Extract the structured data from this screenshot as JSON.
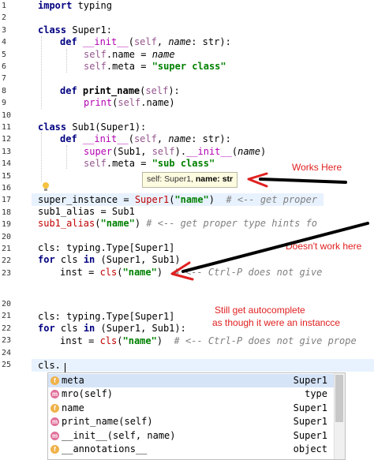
{
  "pane1": {
    "line_numbers": [
      "1",
      "2",
      "3",
      "4",
      "5",
      "6",
      "7",
      "8",
      "9",
      "10",
      "11",
      "12",
      "13",
      "14",
      "15",
      "16",
      "17",
      "18",
      "19",
      "20",
      "21",
      "22",
      "23"
    ],
    "code": {
      "l1": [
        "import",
        " typing"
      ],
      "l3": [
        "class",
        " Super1:"
      ],
      "l4": [
        "def",
        " __init__",
        "(",
        "self",
        ", ",
        "name",
        ": str):"
      ],
      "l5": [
        "self",
        ".name = ",
        "name"
      ],
      "l6": [
        "self",
        ".meta = ",
        "\"super class\""
      ],
      "l8": [
        "def",
        " print_name",
        "(",
        "self",
        "):"
      ],
      "l9": [
        "print",
        "(",
        "self",
        ".name)"
      ],
      "l11": [
        "class",
        " Sub1(Super1):"
      ],
      "l12": [
        "def",
        " __init__",
        "(",
        "self",
        ", ",
        "name",
        ": str):"
      ],
      "l13": [
        "super",
        "(Sub1, ",
        "self",
        ").",
        "__init__",
        "(",
        "name",
        ")"
      ],
      "l14": [
        "self",
        ".meta = ",
        "\"sub class\""
      ],
      "l17": [
        "super_instance = ",
        "Super1",
        "(",
        "\"name\"",
        ")  ",
        "# <-- get proper"
      ],
      "l18": [
        "sub1_alias = Sub1"
      ],
      "l19": [
        "sub1_alias",
        "(",
        "\"name\"",
        ") ",
        "# <-- get proper type hints fo"
      ],
      "l21": [
        "cls: typing.Type[Super1]"
      ],
      "l22": [
        "for",
        " cls ",
        "in",
        " (Super1, Sub1)"
      ],
      "l23": [
        "inst = ",
        "cls",
        "(",
        "\"name\"",
        ")  ",
        "# <-- Ctrl-P does not give"
      ]
    },
    "tooltip": {
      "prefix": "self: Super1, ",
      "bold": "name: str"
    }
  },
  "pane2": {
    "line_numbers": [
      "20",
      "21",
      "22",
      "23",
      "24",
      "25"
    ],
    "code": {
      "l21": [
        "cls: typing.Type[Super1]"
      ],
      "l22": [
        "for",
        " cls ",
        "in",
        " (Super1, Sub1):"
      ],
      "l23": [
        "inst = ",
        "cls",
        "(",
        "\"name\"",
        ")  ",
        "# <-- Ctrl-P does not give prope"
      ],
      "l25": [
        "cls."
      ]
    },
    "autocomplete": [
      {
        "icon": "f",
        "name": "meta",
        "type": "Super1",
        "selected": true
      },
      {
        "icon": "m",
        "name": "mro(self)",
        "type": "type",
        "selected": false
      },
      {
        "icon": "f",
        "name": "name",
        "type": "Super1",
        "selected": false
      },
      {
        "icon": "m",
        "name": "print_name(self)",
        "type": "Super1",
        "selected": false
      },
      {
        "icon": "m",
        "name": "__init__(self, name)",
        "type": "Super1",
        "selected": false
      },
      {
        "icon": "f",
        "name": "__annotations__",
        "type": "object",
        "selected": false
      }
    ]
  },
  "annotations": {
    "works": "Works Here",
    "doesnt": "Doesn't work here",
    "still_line1": "Still get autocomplete",
    "still_line2": "as though it were an instancce"
  },
  "colors": {
    "annotation": "#e02020",
    "arrow": "#000000",
    "arrow_head": "#e02020"
  }
}
